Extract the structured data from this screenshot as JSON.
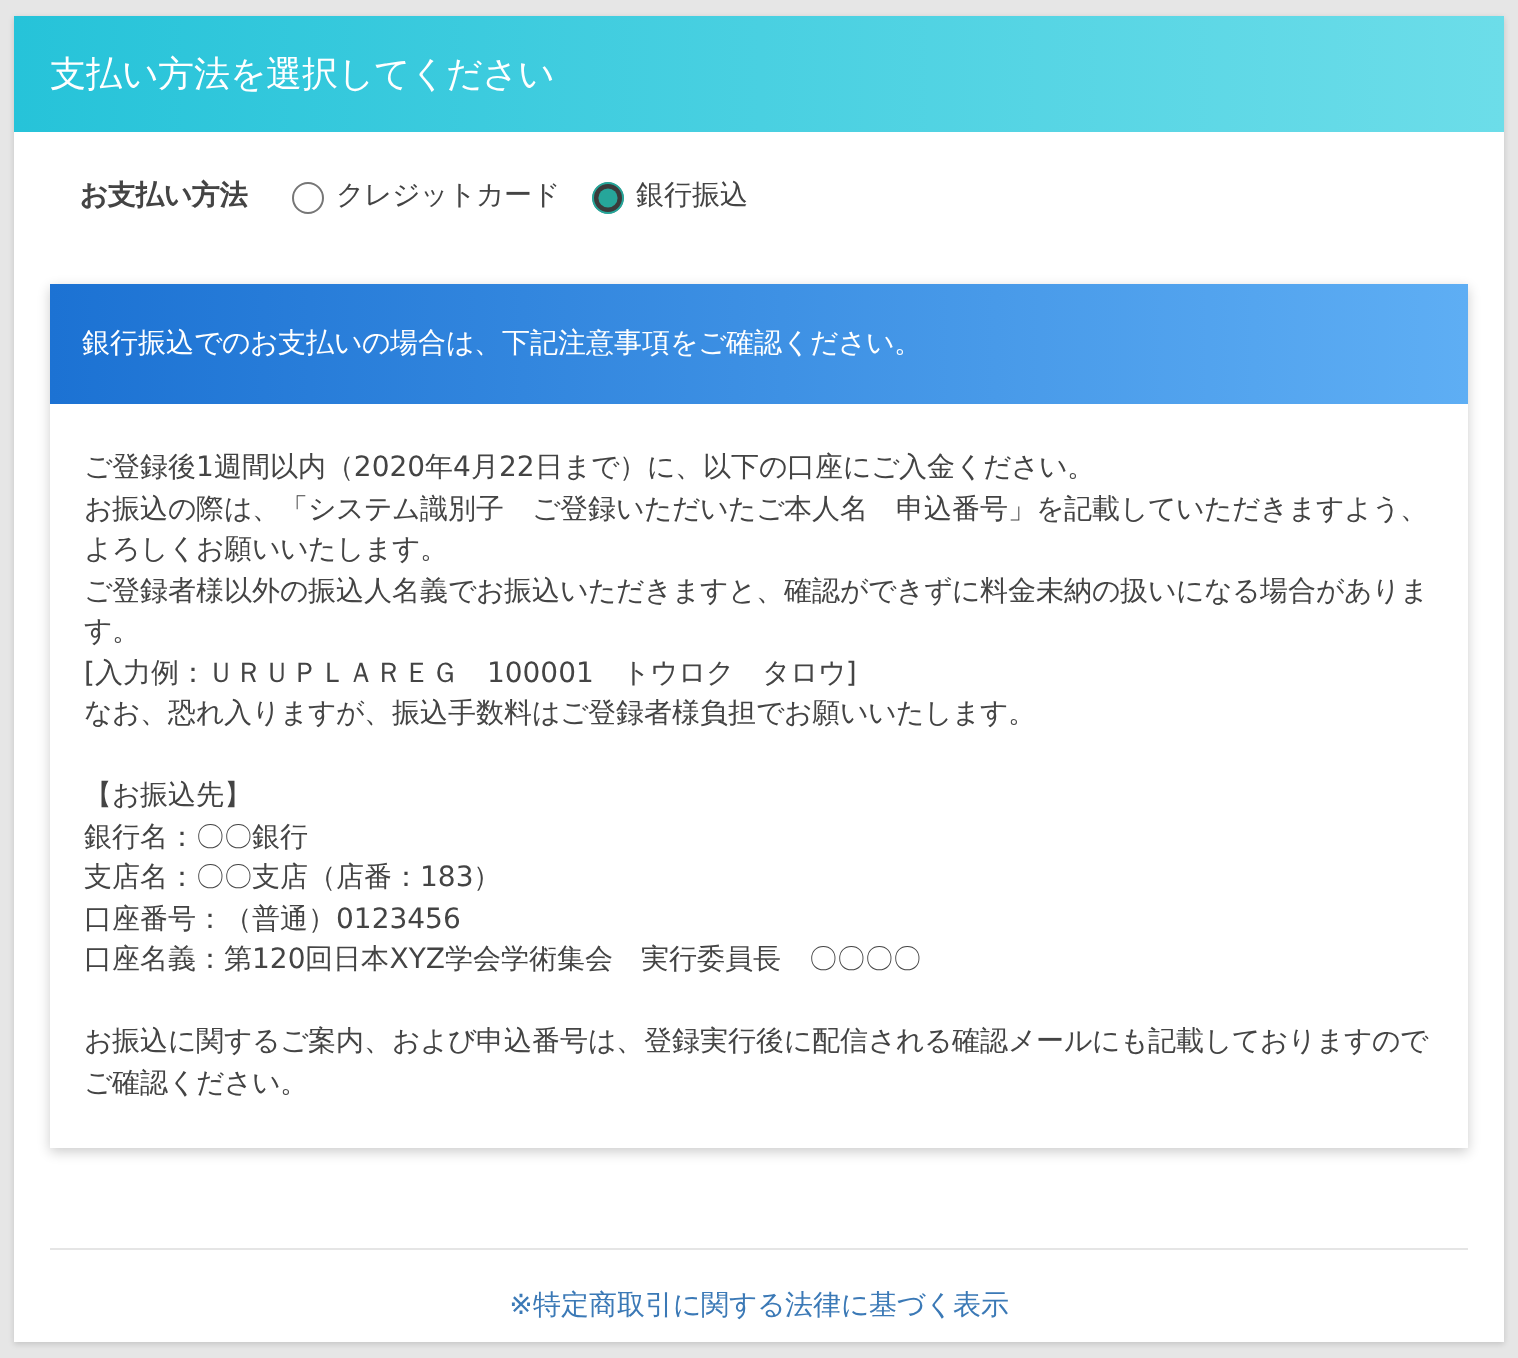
{
  "header": {
    "title": "支払い方法を選択してください"
  },
  "payment_method": {
    "label": "お支払い方法",
    "options": [
      {
        "label": "クレジットカード",
        "selected": false
      },
      {
        "label": "銀行振込",
        "selected": true
      }
    ]
  },
  "notice": {
    "title": "銀行振込でのお支払いの場合は、下記注意事項をご確認ください。",
    "paragraphs": [
      [
        "ご登録後1週間以内（2020年4月22日まで）に、以下の口座にご入金ください。",
        "お振込の際は、「システム識別子　ご登録いただいたご本人名　申込番号」を記載していただきますよう、よろしくお願いいたします。",
        "ご登録者様以外の振込人名義でお振込いただきますと、確認ができずに料金未納の扱いになる場合があります。",
        "[入力例：ＵＲＵＰＬＡＲＥＧ　100001　トウロク　タロウ]",
        "なお、恐れ入りますが、振込手数料はご登録者様負担でお願いいたします。"
      ],
      [
        "【お振込先】",
        "銀行名：〇〇銀行",
        "支店名：〇〇支店（店番：183）",
        "口座番号：（普通）0123456",
        "口座名義：第120回日本XYZ学会学術集会　実行委員長　〇〇〇〇"
      ],
      [
        "お振込に関するご案内、および申込番号は、登録実行後に配信される確認メールにも記載しておりますのでご確認ください。"
      ]
    ]
  },
  "footer": {
    "link": "※特定商取引に関する法律に基づく表示"
  }
}
